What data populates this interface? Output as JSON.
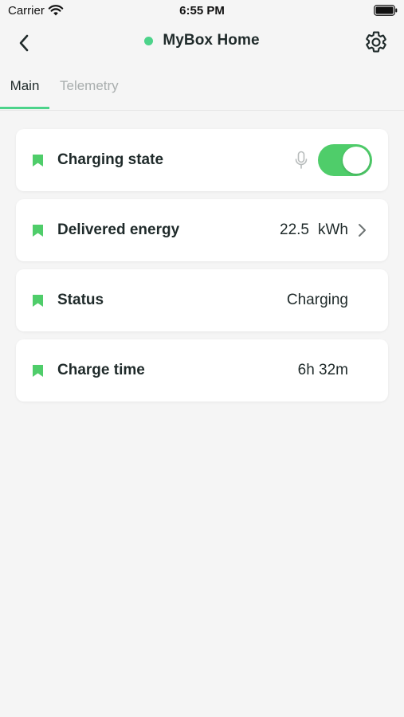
{
  "status_bar": {
    "carrier": "Carrier",
    "time": "6:55 PM"
  },
  "header": {
    "title": "MyBox Home",
    "status_color": "#4cd38a",
    "back_icon": "chevron-left-icon",
    "settings_icon": "gear-icon"
  },
  "tabs": [
    {
      "label": "Main",
      "active": true
    },
    {
      "label": "Telemetry",
      "active": false
    }
  ],
  "accent_color": "#4cd38a",
  "cards": [
    {
      "label": "Charging state",
      "toggle_on": true,
      "icon": "bookmark-icon"
    },
    {
      "label": "Delivered energy",
      "value": "22.5",
      "unit": "kWh",
      "icon": "bookmark-icon"
    },
    {
      "label": "Status",
      "value": "Charging",
      "icon": "bookmark-icon"
    },
    {
      "label": "Charge time",
      "value": "6h 32m",
      "icon": "bookmark-icon"
    }
  ]
}
